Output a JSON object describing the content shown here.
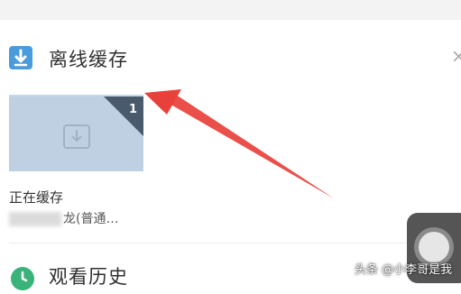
{
  "section": {
    "title": "离线缓存",
    "close_glyph": "×",
    "icon": "download-icon"
  },
  "cache_item": {
    "badge_count": "1",
    "title": "正在缓存",
    "subtitle": "龙(普通…",
    "thumb_icon": "download-tray-icon"
  },
  "history": {
    "title": "观看历史",
    "icon": "clock-icon"
  },
  "watermark": "头条 @小李哥是我",
  "colors": {
    "accent_blue": "#4a9bdc",
    "thumb_bg": "#bed0e2",
    "badge_bg": "#4a5a6c",
    "history_green": "#3ab37a",
    "arrow_red": "#e8403a"
  }
}
